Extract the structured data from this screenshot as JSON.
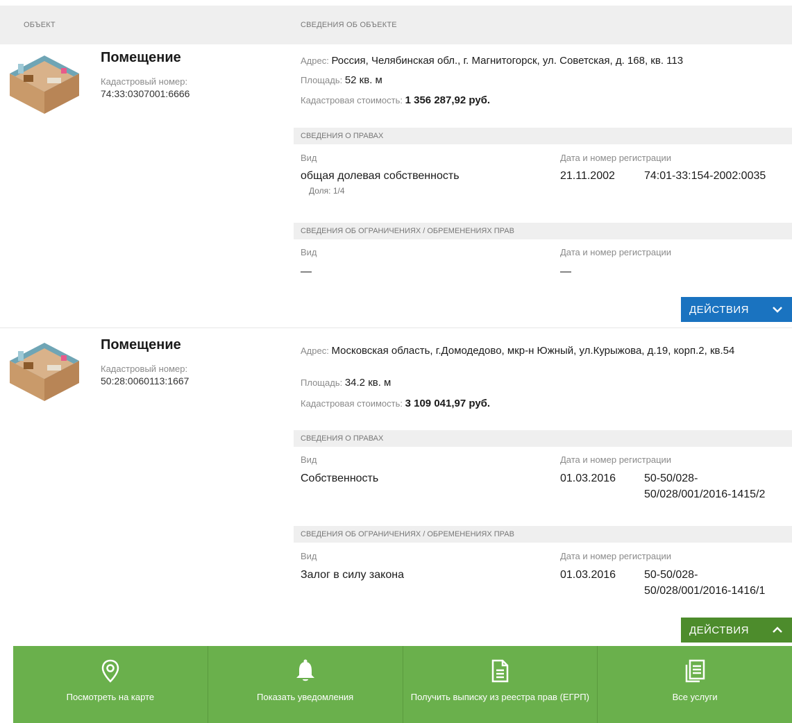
{
  "header": {
    "col_object": "ОБЪЕКТ",
    "col_info": "СВЕДЕНИЯ ОБ ОБЪЕКТЕ"
  },
  "objects": [
    {
      "title": "Помещение",
      "cad_label": "Кадастровый номер:",
      "cad_number": "74:33:0307001:6666",
      "address_label": "Адрес:",
      "address": "Россия, Челябинская обл., г. Магнитогорск, ул. Советская, д. 168, кв. 113",
      "area_label": "Площадь:",
      "area": "52 кв. м",
      "cost_label": "Кадастровая стоимость:",
      "cost": "1 356 287,92 руб.",
      "rights": {
        "title": "СВЕДЕНИЯ О ПРАВАХ",
        "col_type": "Вид",
        "col_reg": "Дата и номер регистрации",
        "type": "общая долевая собственность",
        "share": "Доля: 1/4",
        "date": "21.11.2002",
        "number": "74:01-33:154-2002:0035"
      },
      "restrictions": {
        "title": "СВЕДЕНИЯ ОБ ОГРАНИЧЕНИЯХ / ОБРЕМЕНЕНИЯХ ПРАВ",
        "col_type": "Вид",
        "col_reg": "Дата и номер регистрации",
        "type": "—",
        "reg": "—"
      },
      "actions_label": "ДЕЙСТВИЯ"
    },
    {
      "title": "Помещение",
      "cad_label": "Кадастровый номер:",
      "cad_number": "50:28:0060113:1667",
      "address_label": "Адрес:",
      "address": "Московская область, г.Домодедово, мкр-н Южный, ул.Курыжова, д.19, корп.2, кв.54",
      "area_label": "Площадь:",
      "area": "34.2 кв. м",
      "cost_label": "Кадастровая стоимость:",
      "cost": "3 109 041,97 руб.",
      "rights": {
        "title": "СВЕДЕНИЯ О ПРАВАХ",
        "col_type": "Вид",
        "col_reg": "Дата и номер регистрации",
        "type": "Собственность",
        "date": "01.03.2016",
        "number_l1": "50-50/028-",
        "number_l2": "50/028/001/2016-1415/2"
      },
      "restrictions": {
        "title": "СВЕДЕНИЯ ОБ ОГРАНИЧЕНИЯХ / ОБРЕМЕНЕНИЯХ ПРАВ",
        "col_type": "Вид",
        "col_reg": "Дата и номер регистрации",
        "type": "Залог в силу закона",
        "date": "01.03.2016",
        "number_l1": "50-50/028-",
        "number_l2": "50/028/001/2016-1416/1"
      },
      "actions_label": "ДЕЙСТВИЯ"
    }
  ],
  "action_bar": [
    {
      "label": "Посмотреть на карте",
      "icon": "map-pin-icon"
    },
    {
      "label": "Показать уведомления",
      "icon": "bell-icon"
    },
    {
      "label": "Получить выписку из реестра прав (ЕГРП)",
      "icon": "document-icon"
    },
    {
      "label": "Все услуги",
      "icon": "documents-stack-icon"
    }
  ],
  "colors": {
    "actions_blue": "#1a73c0",
    "actions_green": "#4d8c2c",
    "action_bar_green": "#6ab04c",
    "header_gray": "#efefef"
  }
}
